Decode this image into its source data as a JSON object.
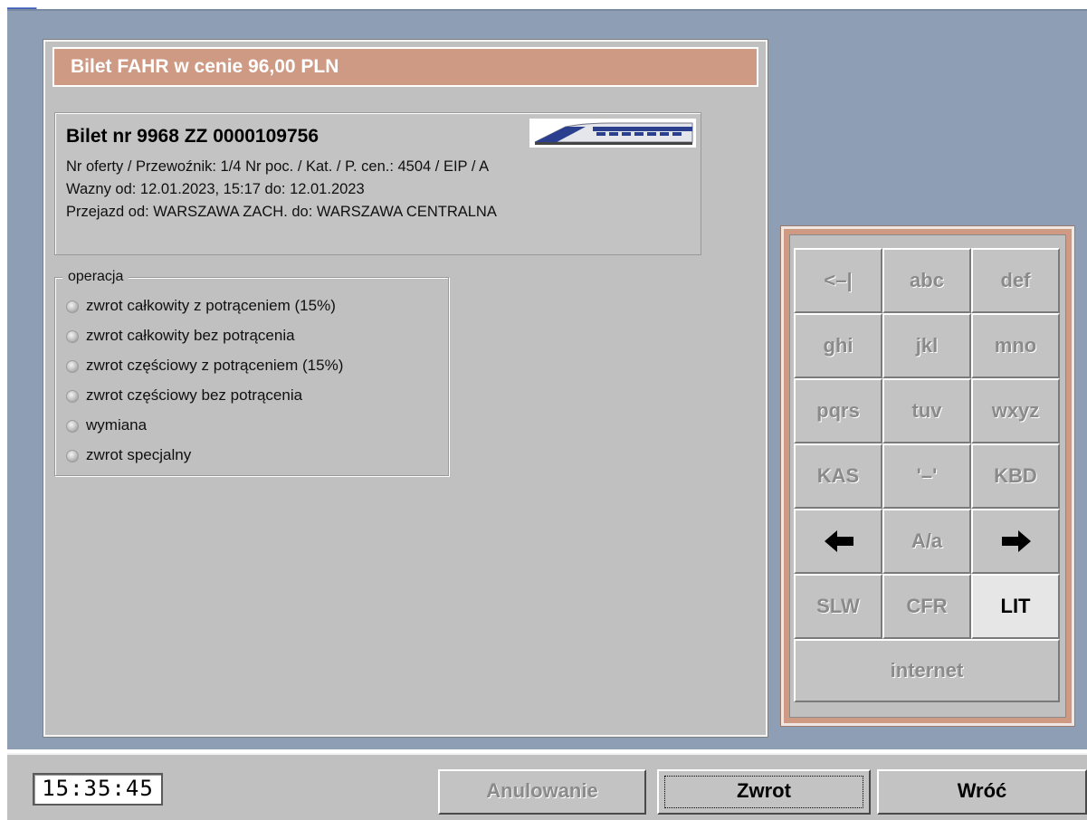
{
  "colors": {
    "workspace": "#8e9fb5",
    "title_bar": "#cf9a84",
    "panel": "#c0c0c0",
    "disabled_text": "#8a8a8a"
  },
  "dialog": {
    "title": "Bilet FAHR w cenie 96,00 PLN",
    "ticket": {
      "number": "Bilet nr 9968 ZZ 0000109756",
      "line_offer": "Nr oferty / Przewoźnik: 1/4   Nr poc. / Kat. / P. cen.: 4504 / EIP / A",
      "line_valid": "Wazny od: 12.01.2023, 15:17 do: 12.01.2023",
      "line_route": "Przejazd od: WARSZAWA ZACH. do: WARSZAWA CENTRALNA",
      "logo_icon": "train-icon"
    },
    "operation": {
      "legend": "operacja",
      "options": [
        {
          "label": "zwrot całkowity z potrąceniem (15%)",
          "selected": false
        },
        {
          "label": "zwrot całkowity bez potrącenia",
          "selected": false
        },
        {
          "label": "zwrot częściowy z potrąceniem (15%)",
          "selected": false
        },
        {
          "label": "zwrot częściowy bez potrącenia",
          "selected": false
        },
        {
          "label": "wymiana",
          "selected": false
        },
        {
          "label": "zwrot specjalny",
          "selected": false
        }
      ]
    }
  },
  "keypad": {
    "keys": [
      "<–|",
      "abc",
      "def",
      "ghi",
      "jkl",
      "mno",
      "pqrs",
      "tuv",
      "wxyz",
      "KAS",
      "'–'",
      "KBD",
      "A/a",
      "SLW",
      "CFR",
      "LIT",
      "internet"
    ],
    "active_key": "LIT",
    "arrow_left_icon": "arrow-left-icon",
    "arrow_right_icon": "arrow-right-icon"
  },
  "bottom_bar": {
    "clock": "15:35:45",
    "buttons": {
      "cancel": "Anulowanie",
      "refund": "Zwrot",
      "back": "Wróć"
    }
  }
}
